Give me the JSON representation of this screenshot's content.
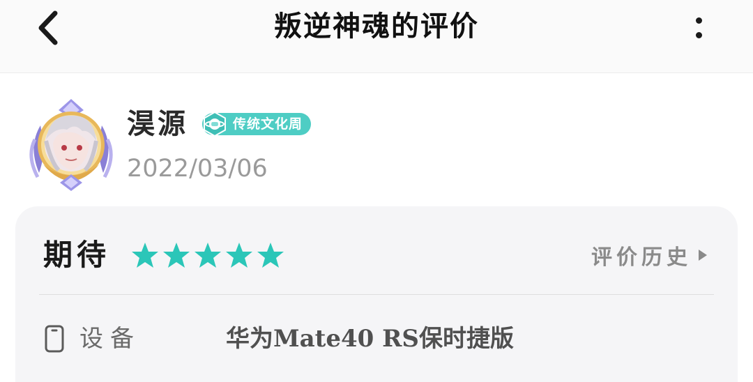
{
  "header": {
    "title": "叛逆神魂的评价",
    "back_icon": "chevron-left-icon",
    "more_icon": "more-vertical-icon"
  },
  "user": {
    "name": "淏源",
    "badge_label": "传统文化周",
    "badge_color": "#4ecdc4",
    "date": "2022/03/06",
    "avatar_icon": "avatar-with-laurel-frame"
  },
  "review": {
    "rating_label": "期待",
    "stars": 5,
    "star_color": "#2bc6b8",
    "history_label": "评价历史",
    "history_icon": "triangle-right-icon",
    "device_icon": "phone-icon",
    "device_label": "设备",
    "device_value": "华为Mate40 RS保时捷版"
  }
}
